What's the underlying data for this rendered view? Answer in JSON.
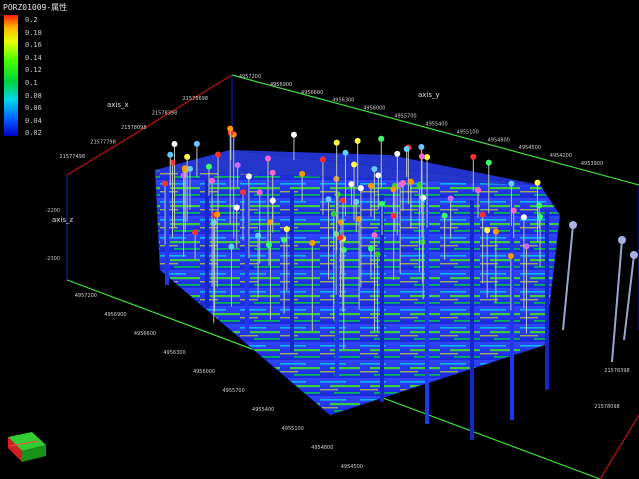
{
  "legend": {
    "title": "PORZ01009-属性",
    "ticks": [
      "0.2",
      "0.18",
      "0.16",
      "0.14",
      "0.12",
      "0.1",
      "0.08",
      "0.06",
      "0.04",
      "0.02"
    ]
  },
  "axes": {
    "x_label": "axis_x",
    "y_label": "axis_y",
    "z_label": "axis_z",
    "z_ticks": [
      "-2200",
      "-2300"
    ],
    "x_ticks_top": [
      "21578698",
      "21578398",
      "21578098",
      "21577798",
      "21577498"
    ],
    "y_ticks_top": [
      "4957200",
      "4956900",
      "4956600",
      "4956300",
      "4956000",
      "4955700",
      "4955400",
      "4955100",
      "4954800",
      "4954500",
      "4954200",
      "4953900"
    ],
    "y_ticks_front": [
      "4957200",
      "4956900",
      "4956600",
      "4956300",
      "4956000",
      "4955700",
      "4955400",
      "4955100",
      "4954800",
      "4954500"
    ],
    "x_ticks_right": [
      "21578098",
      "21578398"
    ]
  },
  "colors": {
    "axis_red": "#c01010",
    "axis_green": "#40e040",
    "axis_blue": "#2020c0",
    "section_base": "#2a3ff0"
  }
}
